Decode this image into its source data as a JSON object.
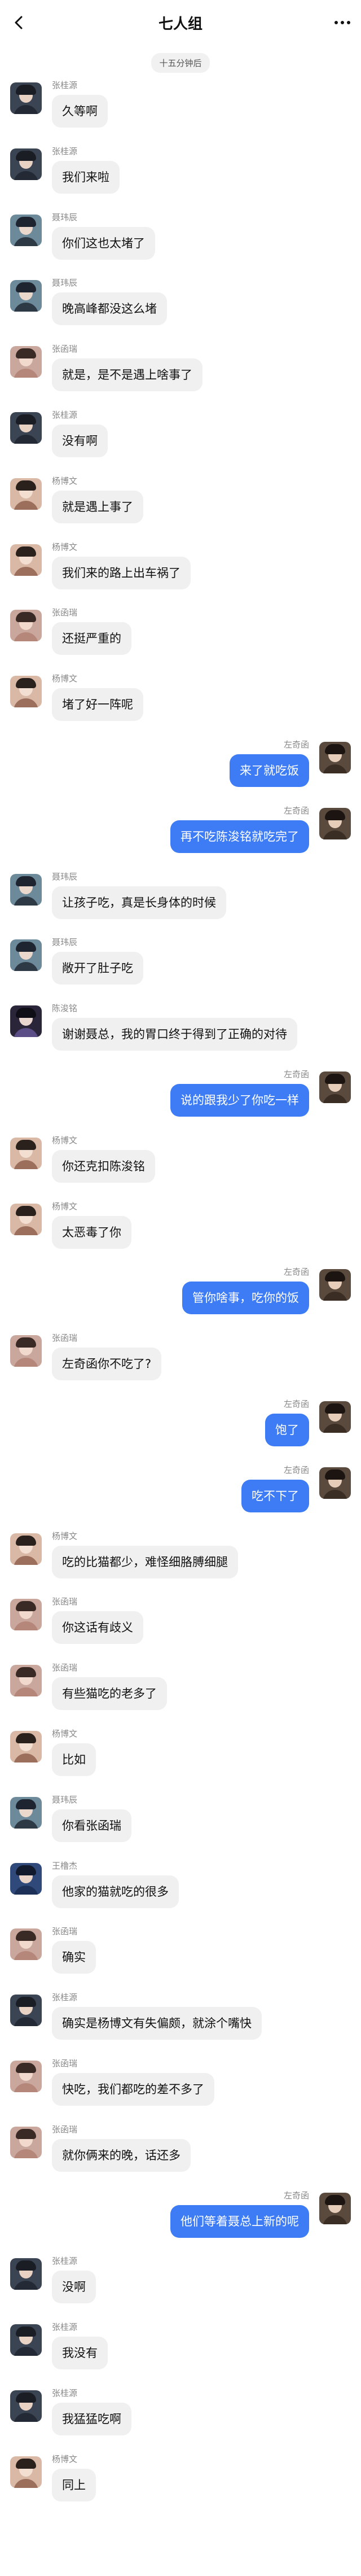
{
  "header": {
    "title": "七人组",
    "back_icon": "chevron-left-icon",
    "more_icon": "more-dots-icon"
  },
  "time_divider": "十五分钟后",
  "messages": [
    {
      "side": "left",
      "name": "张桂源",
      "text": "久等啊",
      "avatar": {
        "bg": "#3b4453",
        "hair": "#1a1d24",
        "face": "#e8d2c4",
        "body": "#232a36"
      }
    },
    {
      "side": "left",
      "name": "张桂源",
      "text": "我们来啦",
      "avatar": {
        "bg": "#3b4453",
        "hair": "#1a1d24",
        "face": "#e8d2c4",
        "body": "#232a36"
      }
    },
    {
      "side": "left",
      "name": "聂玮辰",
      "text": "你们这也太堵了",
      "avatar": {
        "bg": "#6d8a9a",
        "hair": "#1e2430",
        "face": "#ead8cc",
        "body": "#2d3a46"
      }
    },
    {
      "side": "left",
      "name": "聂玮辰",
      "text": "晚高峰都没这么堵",
      "avatar": {
        "bg": "#6d8a9a",
        "hair": "#1e2430",
        "face": "#ead8cc",
        "body": "#2d3a46"
      }
    },
    {
      "side": "left",
      "name": "张函瑞",
      "text": "就是，是不是遇上啥事了",
      "avatar": {
        "bg": "#caa79c",
        "hair": "#3a2a26",
        "face": "#f1d9cd",
        "body": "#b5877b"
      }
    },
    {
      "side": "left",
      "name": "张桂源",
      "text": "没有啊",
      "avatar": {
        "bg": "#3b4453",
        "hair": "#1a1d24",
        "face": "#e8d2c4",
        "body": "#232a36"
      }
    },
    {
      "side": "left",
      "name": "杨博文",
      "text": "就是遇上事了",
      "avatar": {
        "bg": "#d9b8a6",
        "hair": "#2a211d",
        "face": "#f3dfd2",
        "body": "#9c6f5c"
      }
    },
    {
      "side": "left",
      "name": "杨博文",
      "text": "我们来的路上出车祸了",
      "avatar": {
        "bg": "#d9b8a6",
        "hair": "#2a211d",
        "face": "#f3dfd2",
        "body": "#9c6f5c"
      }
    },
    {
      "side": "left",
      "name": "张函瑞",
      "text": "还挺严重的",
      "avatar": {
        "bg": "#caa79c",
        "hair": "#3a2a26",
        "face": "#f1d9cd",
        "body": "#b5877b"
      }
    },
    {
      "side": "left",
      "name": "杨博文",
      "text": "堵了好一阵呢",
      "avatar": {
        "bg": "#d9b8a6",
        "hair": "#2a211d",
        "face": "#f3dfd2",
        "body": "#9c6f5c"
      }
    },
    {
      "side": "right",
      "name": "左奇函",
      "text": "来了就吃饭",
      "avatar": {
        "bg": "#5a4a3e",
        "hair": "#1b1410",
        "face": "#e6cdb9",
        "body": "#3a2d24"
      }
    },
    {
      "side": "right",
      "name": "左奇函",
      "text": "再不吃陈浚铭就吃完了",
      "avatar": {
        "bg": "#5a4a3e",
        "hair": "#1b1410",
        "face": "#e6cdb9",
        "body": "#3a2d24"
      }
    },
    {
      "side": "left",
      "name": "聂玮辰",
      "text": "让孩子吃，真是长身体的时候",
      "avatar": {
        "bg": "#6d8a9a",
        "hair": "#1e2430",
        "face": "#ead8cc",
        "body": "#2d3a46"
      }
    },
    {
      "side": "left",
      "name": "聂玮辰",
      "text": "敞开了肚子吃",
      "avatar": {
        "bg": "#6d8a9a",
        "hair": "#1e2430",
        "face": "#ead8cc",
        "body": "#2d3a46"
      }
    },
    {
      "side": "left",
      "name": "陈浚铭",
      "text": "谢谢聂总，我的胃口终于得到了正确的对待",
      "avatar": {
        "bg": "#2a2538",
        "hair": "#0f0d16",
        "face": "#e9d6cf",
        "body": "#5b4d86"
      }
    },
    {
      "side": "right",
      "name": "左奇函",
      "text": "说的跟我少了你吃一样",
      "avatar": {
        "bg": "#5a4a3e",
        "hair": "#1b1410",
        "face": "#e6cdb9",
        "body": "#3a2d24"
      }
    },
    {
      "side": "left",
      "name": "杨博文",
      "text": "你还克扣陈浚铭",
      "avatar": {
        "bg": "#d9b8a6",
        "hair": "#2a211d",
        "face": "#f3dfd2",
        "body": "#9c6f5c"
      }
    },
    {
      "side": "left",
      "name": "杨博文",
      "text": "太恶毒了你",
      "avatar": {
        "bg": "#d9b8a6",
        "hair": "#2a211d",
        "face": "#f3dfd2",
        "body": "#9c6f5c"
      }
    },
    {
      "side": "right",
      "name": "左奇函",
      "text": "管你啥事，吃你的饭",
      "avatar": {
        "bg": "#5a4a3e",
        "hair": "#1b1410",
        "face": "#e6cdb9",
        "body": "#3a2d24"
      }
    },
    {
      "side": "left",
      "name": "张函瑞",
      "text": "左奇函你不吃了?",
      "avatar": {
        "bg": "#caa79c",
        "hair": "#3a2a26",
        "face": "#f1d9cd",
        "body": "#b5877b"
      }
    },
    {
      "side": "right",
      "name": "左奇函",
      "text": "饱了",
      "avatar": {
        "bg": "#5a4a3e",
        "hair": "#1b1410",
        "face": "#e6cdb9",
        "body": "#3a2d24"
      }
    },
    {
      "side": "right",
      "name": "左奇函",
      "text": "吃不下了",
      "avatar": {
        "bg": "#5a4a3e",
        "hair": "#1b1410",
        "face": "#e6cdb9",
        "body": "#3a2d24"
      }
    },
    {
      "side": "left",
      "name": "杨博文",
      "text": "吃的比猫都少，难怪细胳膊细腿",
      "avatar": {
        "bg": "#d9b8a6",
        "hair": "#2a211d",
        "face": "#f3dfd2",
        "body": "#9c6f5c"
      }
    },
    {
      "side": "left",
      "name": "张函瑞",
      "text": "你这话有歧义",
      "avatar": {
        "bg": "#caa79c",
        "hair": "#3a2a26",
        "face": "#f1d9cd",
        "body": "#b5877b"
      }
    },
    {
      "side": "left",
      "name": "张函瑞",
      "text": "有些猫吃的老多了",
      "avatar": {
        "bg": "#caa79c",
        "hair": "#3a2a26",
        "face": "#f1d9cd",
        "body": "#b5877b"
      }
    },
    {
      "side": "left",
      "name": "杨博文",
      "text": "比如",
      "avatar": {
        "bg": "#d9b8a6",
        "hair": "#2a211d",
        "face": "#f3dfd2",
        "body": "#9c6f5c"
      }
    },
    {
      "side": "left",
      "name": "聂玮辰",
      "text": "你看张函瑞",
      "avatar": {
        "bg": "#6d8a9a",
        "hair": "#1e2430",
        "face": "#ead8cc",
        "body": "#2d3a46"
      }
    },
    {
      "side": "left",
      "name": "王橹杰",
      "text": "他家的猫就吃的很多",
      "avatar": {
        "bg": "#2f4a7a",
        "hair": "#101a2c",
        "face": "#e8d4c8",
        "body": "#1d3158"
      }
    },
    {
      "side": "left",
      "name": "张函瑞",
      "text": "确实",
      "avatar": {
        "bg": "#caa79c",
        "hair": "#3a2a26",
        "face": "#f1d9cd",
        "body": "#b5877b"
      }
    },
    {
      "side": "left",
      "name": "张桂源",
      "text": "确实是杨博文有失偏颇，就涂个嘴快",
      "avatar": {
        "bg": "#3b4453",
        "hair": "#1a1d24",
        "face": "#e8d2c4",
        "body": "#232a36"
      }
    },
    {
      "side": "left",
      "name": "张函瑞",
      "text": "快吃，我们都吃的差不多了",
      "avatar": {
        "bg": "#caa79c",
        "hair": "#3a2a26",
        "face": "#f1d9cd",
        "body": "#b5877b"
      }
    },
    {
      "side": "left",
      "name": "张函瑞",
      "text": "就你俩来的晚，话还多",
      "avatar": {
        "bg": "#caa79c",
        "hair": "#3a2a26",
        "face": "#f1d9cd",
        "body": "#b5877b"
      }
    },
    {
      "side": "right",
      "name": "左奇函",
      "text": "他们等着聂总上新的呢",
      "avatar": {
        "bg": "#5a4a3e",
        "hair": "#1b1410",
        "face": "#e6cdb9",
        "body": "#3a2d24"
      }
    },
    {
      "side": "left",
      "name": "张桂源",
      "text": "没啊",
      "avatar": {
        "bg": "#3b4453",
        "hair": "#1a1d24",
        "face": "#e8d2c4",
        "body": "#232a36"
      }
    },
    {
      "side": "left",
      "name": "张桂源",
      "text": "我没有",
      "avatar": {
        "bg": "#3b4453",
        "hair": "#1a1d24",
        "face": "#e8d2c4",
        "body": "#232a36"
      }
    },
    {
      "side": "left",
      "name": "张桂源",
      "text": "我猛猛吃啊",
      "avatar": {
        "bg": "#3b4453",
        "hair": "#1a1d24",
        "face": "#e8d2c4",
        "body": "#232a36"
      }
    },
    {
      "side": "left",
      "name": "杨博文",
      "text": "同上",
      "avatar": {
        "bg": "#d9b8a6",
        "hair": "#2a211d",
        "face": "#f3dfd2",
        "body": "#9c6f5c"
      }
    }
  ]
}
